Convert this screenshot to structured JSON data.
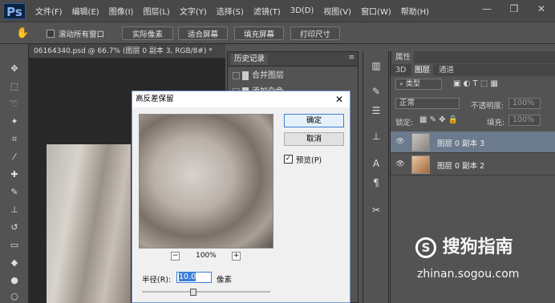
{
  "app": {
    "logo": "Ps"
  },
  "menu": [
    "文件(F)",
    "编辑(E)",
    "图像(I)",
    "图层(L)",
    "文字(Y)",
    "选择(S)",
    "滤镜(T)",
    "3D(D)",
    "视图(V)",
    "窗口(W)",
    "帮助(H)"
  ],
  "window_controls": {
    "minimize": "—",
    "restore": "❐",
    "close": "✕"
  },
  "options_bar": {
    "scroll_all_label": "滚动所有窗口",
    "btn_actual_pixels": "实际像素",
    "btn_fit_screen": "适合屏幕",
    "btn_fill_screen": "填充屏幕",
    "btn_print_size": "打印尺寸"
  },
  "document": {
    "tab_title": "06164340.psd @ 66.7% (图层 0 副本 3, RGB/8#) *",
    "close_icon": "×"
  },
  "history_panel": {
    "tab_label": "历史记录",
    "items": [
      "合并图层",
      "添加杂色"
    ]
  },
  "layers_panel": {
    "tab_properties": "属性",
    "tabs": [
      "3D",
      "图层",
      "通道"
    ],
    "filter_label": "类型",
    "blend_mode": "正常",
    "opacity_label": "不透明度:",
    "opacity_value": "100%",
    "lock_label": "锁定:",
    "fill_label": "填充:",
    "fill_value": "100%",
    "layers": [
      {
        "name": "图层 0 副本 3",
        "selected": true
      },
      {
        "name": "图层 0 副本 2",
        "selected": false
      }
    ]
  },
  "dialog": {
    "title": "高反差保留",
    "ok_label": "确定",
    "cancel_label": "取消",
    "preview_label": "预览(P)",
    "preview_checked": true,
    "zoom_value": "100%",
    "zoom_out": "−",
    "zoom_in": "+",
    "radius_label": "半径(R):",
    "radius_value": "10.0",
    "radius_unit": "像素",
    "close_icon": "✕"
  },
  "watermark": {
    "line1": "搜狗指南",
    "line2": "zhinan.sogou.com"
  },
  "colors": {
    "accent": "#3c7fd6",
    "panel_bg": "#535353",
    "dialog_bg": "#f0f0f0"
  }
}
